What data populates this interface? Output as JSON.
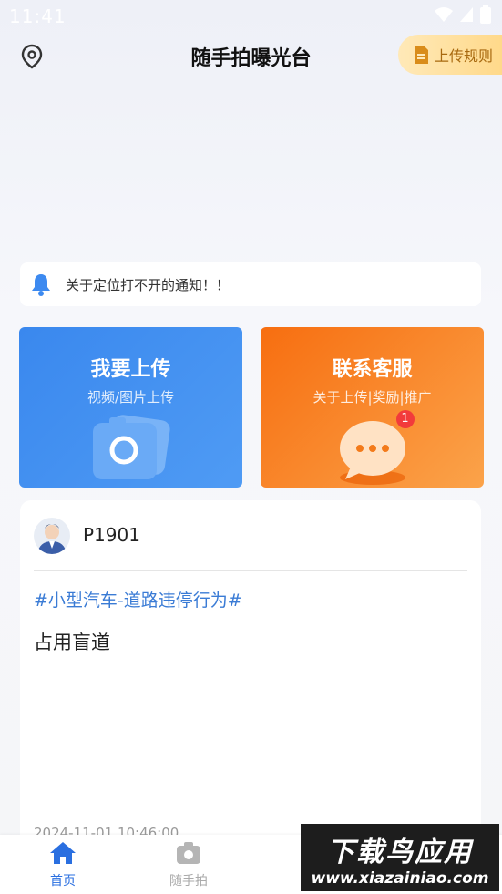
{
  "status": {
    "time": "11:41"
  },
  "header": {
    "title": "随手拍曝光台",
    "rules_label": "上传规则"
  },
  "notice": {
    "text": "关于定位打不开的通知！！"
  },
  "cards": {
    "upload": {
      "title": "我要上传",
      "subtitle": "视频/图片上传"
    },
    "service": {
      "title": "联系客服",
      "subtitle": "关于上传|奖励|推广",
      "badge": "1"
    }
  },
  "post": {
    "username": "P1901",
    "tag": "#小型汽车-道路违停行为#",
    "content": "占用盲道",
    "time": "2024-11-01 10:46:00"
  },
  "tabbar": {
    "home_label": "首页",
    "shot_label": "随手拍"
  },
  "watermark": {
    "main": "下载鸟应用",
    "url": "www.xiazainiao.com"
  },
  "colors": {
    "accent": "#2a6fe0",
    "upload_card": "#3a88ee",
    "service_card": "#f76e10",
    "rules_btn": "#ffd98a"
  }
}
